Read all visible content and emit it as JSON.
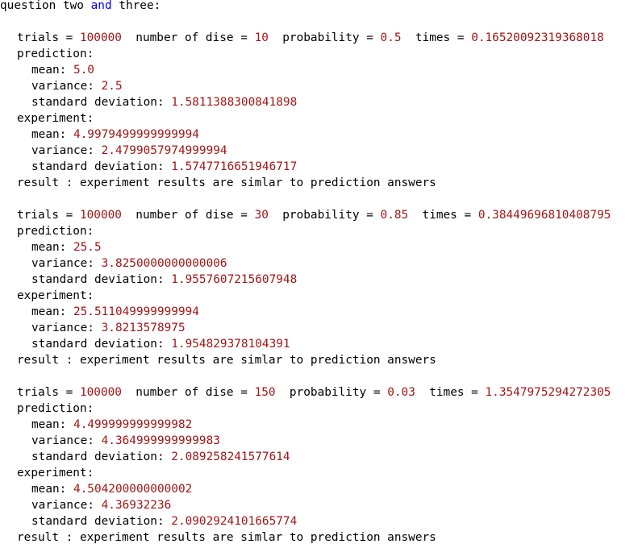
{
  "heading": {
    "before": "question two ",
    "keyword": "and",
    "after": " three:"
  },
  "labels": {
    "trials": "trials = ",
    "dice": "number of dise = ",
    "probability": "probability = ",
    "times": "times = ",
    "prediction": "prediction:",
    "experiment": "experiment:",
    "mean": "mean: ",
    "variance": "variance: ",
    "std": "standard deviation: ",
    "result": "result : experiment results are simlar to prediction answers"
  },
  "runs": [
    {
      "trials": "100000",
      "dice": "10",
      "probability": "0.5",
      "times": "0.16520092319368018",
      "prediction": {
        "mean": "5.0",
        "variance": "2.5",
        "std": "1.5811388300841898"
      },
      "experiment": {
        "mean": "4.9979499999999994",
        "variance": "2.4799057974999994",
        "std": "1.5747716651946717"
      }
    },
    {
      "trials": "100000",
      "dice": "30",
      "probability": "0.85",
      "times": "0.38449696810408795",
      "prediction": {
        "mean": "25.5",
        "variance": "3.8250000000000006",
        "std": "1.9557607215607948"
      },
      "experiment": {
        "mean": "25.511049999999994",
        "variance": "3.8213578975",
        "std": "1.954829378104391"
      }
    },
    {
      "trials": "100000",
      "dice": "150",
      "probability": "0.03",
      "times": "1.3547975294272305",
      "prediction": {
        "mean": "4.499999999999982",
        "variance": "4.364999999999983",
        "std": "2.089258241577614"
      },
      "experiment": {
        "mean": "4.504200000000002",
        "variance": "4.36932236",
        "std": "2.0902924101665774"
      }
    }
  ]
}
